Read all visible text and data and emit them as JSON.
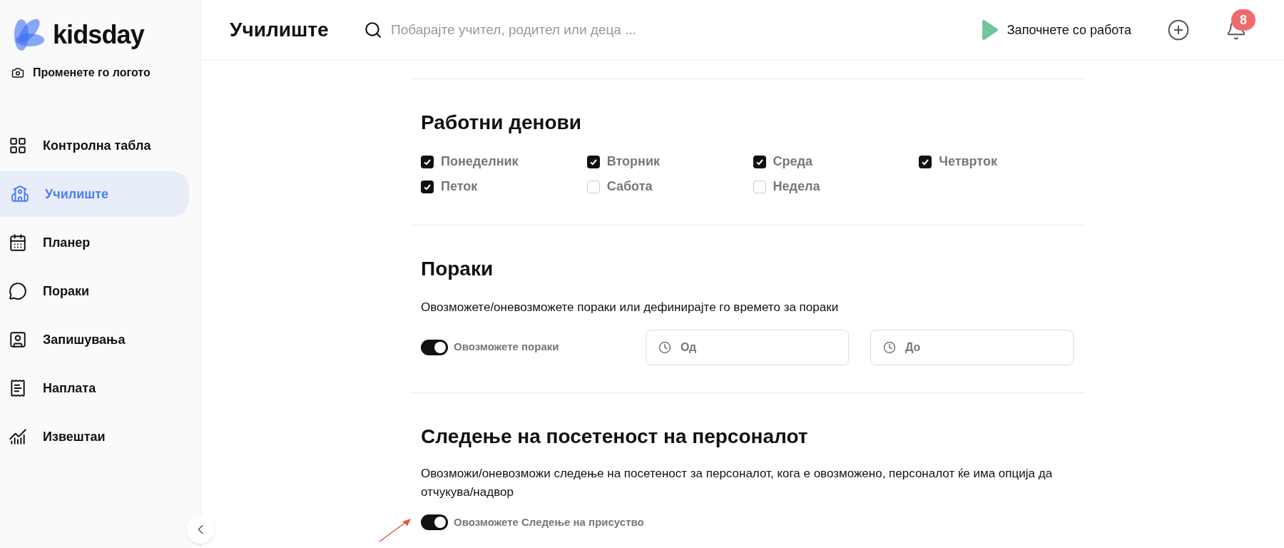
{
  "brand": {
    "name": "kidsday",
    "change_logo": "Променете го логото"
  },
  "sidebar": {
    "items": [
      {
        "label": "Контролна табла",
        "selected": false
      },
      {
        "label": "Училиште",
        "selected": true
      },
      {
        "label": "Планер",
        "selected": false
      },
      {
        "label": "Пораки",
        "selected": false
      },
      {
        "label": "Запишувања",
        "selected": false
      },
      {
        "label": "Наплата",
        "selected": false
      },
      {
        "label": "Извештаи",
        "selected": false
      }
    ]
  },
  "header": {
    "title": "Училиште",
    "search": {
      "placeholder": "Побарајте учител, родител или деца ..."
    },
    "start_button": "Започнете со работа",
    "notifications": "8"
  },
  "working_days": {
    "title": "Работни денови",
    "days": [
      {
        "label": "Понеделник",
        "checked": true
      },
      {
        "label": "Вторник",
        "checked": true
      },
      {
        "label": "Среда",
        "checked": true
      },
      {
        "label": "Четврток",
        "checked": true
      },
      {
        "label": "Петок",
        "checked": true
      },
      {
        "label": "Сабота",
        "checked": false
      },
      {
        "label": "Недела",
        "checked": false
      }
    ]
  },
  "messages": {
    "title": "Пораки",
    "description": "Овозможете/оневозможете пораки или дефинирајте го времето за пораки",
    "toggle": {
      "label": "Овозможете пораки",
      "on": true
    },
    "from": {
      "placeholder": "Од"
    },
    "to": {
      "placeholder": "До"
    }
  },
  "attendance": {
    "title": "Следење на посетеност на персоналот",
    "description": "Овозможи/оневозможи следење на посетеност за персоналот, кога е овозможено, персоналот ќе има опција да отчукува/надвор",
    "toggle": {
      "label": "Овозможете Следење на присуство",
      "on": true
    }
  }
}
